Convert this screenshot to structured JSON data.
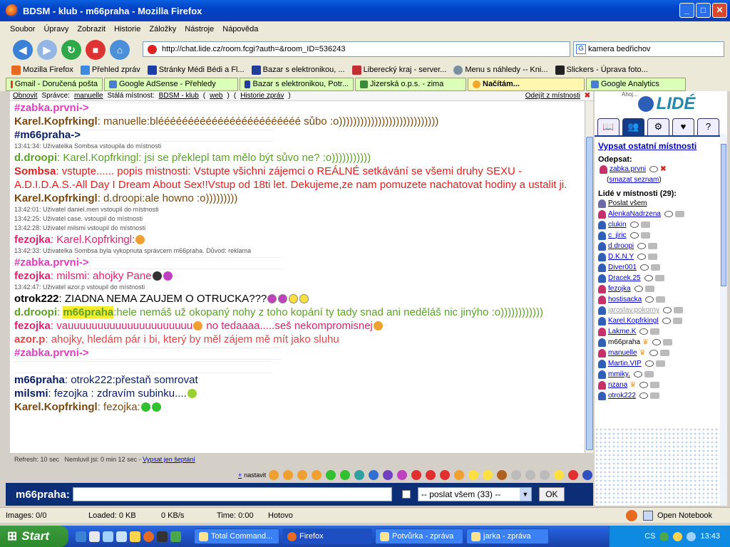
{
  "window": {
    "title": "BDSM - klub - m66praha - Mozilla Firefox"
  },
  "menu": [
    "Soubor",
    "Úpravy",
    "Zobrazit",
    "Historie",
    "Záložky",
    "Nástroje",
    "Nápověda"
  ],
  "address": {
    "url": "http://chat.lide.cz/room.fcgi?auth=&room_ID=536243"
  },
  "search": {
    "value": "kamera bedřichov"
  },
  "bookmarks": [
    {
      "label": "Mozilla Firefox",
      "color": "#e66a1f"
    },
    {
      "label": "Přehled zpráv",
      "color": "#3e8ae0"
    },
    {
      "label": "Stránky Médi Bédi a Fl...",
      "color": "#1b3ea8"
    },
    {
      "label": "Bazar s elektronikou, ...",
      "color": "#223d9a"
    },
    {
      "label": "Liberecký kraj - server...",
      "color": "#c03030"
    },
    {
      "label": "Menu s náhledy -- Kni...",
      "color": "#7a8fa0"
    },
    {
      "label": "Slickers - Úprava foto...",
      "color": "#222222"
    }
  ],
  "tabs": [
    {
      "label": "Gmail - Doručená pošta",
      "active": false
    },
    {
      "label": "Google AdSense - Přehledy",
      "active": false
    },
    {
      "label": "Bazar s elektronikou, Potr...",
      "active": false
    },
    {
      "label": "Jizerská o.p.s. - zima",
      "active": false
    },
    {
      "label": "Načítám...",
      "active": true
    },
    {
      "label": "Google Analytics",
      "active": false
    }
  ],
  "chatbar": {
    "refresh": "Obnovit",
    "admin_label": "Správce:",
    "admin": "manuelle",
    "room_label": "Stálá místnost:",
    "room": "BDSM - klub",
    "web": "web",
    "history": "Historie zpráv",
    "leave": "Odejít z místnosti"
  },
  "messages": [
    {
      "type": "whisper",
      "nick": "#zabka.prvni->",
      "text": "",
      "color": "#e040c0"
    },
    {
      "type": "msg",
      "nick": "Karel.Kopfrkingl",
      "text": ": manuelle:bléééééééééééééééééééééééé sůbo :o))))))))))))))))))))))))))))",
      "color": "#7a4a12"
    },
    {
      "type": "whisper",
      "nick": "#m66praha->",
      "text": "",
      "color": "#0b1f66"
    },
    {
      "type": "sys",
      "text": "13:41:34: Uživatelka Sombsa vstoupila do místnosti"
    },
    {
      "type": "msg",
      "nick": "d.droopi",
      "text": ": Karel.Kopfrkingl: jsi se překlepl tam mělo být sůvo ne? :o)))))))))))",
      "color": "#5ea02c"
    },
    {
      "type": "msg",
      "nick": "Sombsa",
      "text": ": vstupte...... popis mistnosti: Vstupte všichni zájemci o REÁLNÉ setkávání se všemi druhy SEXU - A.D.I.D.A.S.-All Day I Dream About Sex!!Vstup od 18ti let. Dekujeme,ze nam pomuzete nachatovat hodiny a ustalit ji.",
      "color": "#e02020",
      "wrap": true
    },
    {
      "type": "msg",
      "nick": "Karel.Kopfrkingl",
      "text": ": d.droopi:ale howno :o)))))))))",
      "color": "#7a4a12"
    },
    {
      "type": "sys",
      "text": "13:42:01: Uživatel daniel.men vstoupil do místnosti"
    },
    {
      "type": "sys",
      "text": "13:42:25: Uživatel case. vstoupil do místnosti"
    },
    {
      "type": "sys",
      "text": "13:42:28: Uživatel milsmi vstoupil do místnosti"
    },
    {
      "type": "msg",
      "nick": "fezojka",
      "text": ": Karel.Kopfrkingl:",
      "color": "#e0226e"
    },
    {
      "type": "sys",
      "text": "13:42:33: Uživatelka Sombsa byla vykopnuta správcem m66praha. Důvod: reklama"
    },
    {
      "type": "whisper",
      "nick": "#zabka.prvni->",
      "text": "",
      "color": "#e040c0"
    },
    {
      "type": "msg",
      "nick": "fezojka",
      "text": ": milsmi: ahojky Pane",
      "color": "#e0226e"
    },
    {
      "type": "sys",
      "text": "13:42:47: Uživatel azor.p vstoupil do místnosti"
    },
    {
      "type": "msg",
      "nick": "otrok222",
      "text": ": ZIADNA NEMA ZAUJEM O OTRUCKA???",
      "color": "#000000"
    },
    {
      "type": "msg",
      "nick": "d.droopi",
      "text": ": ",
      "highlight": "m66praha",
      "rest": ":hele nemáš už okopaný nohy z toho kopání ty tady snad ani neděláš nic jinýho :o))))))))))))",
      "color": "#5ea02c"
    },
    {
      "type": "msg",
      "nick": "fezojka",
      "text": ": vauuuuuuuuuuuuuuuuuuuuu",
      "rest2": " no tedaaaa.....seš nekompromisnej",
      "color": "#e0226e"
    },
    {
      "type": "msg",
      "nick": "azor.p",
      "text": ": ahojky, hledám pár i bi, který by měl zájem mě mít jako sluhu",
      "color": "#e04848"
    },
    {
      "type": "whisper2",
      "nick": "#zabka.prvni->",
      "text": "",
      "color": "#e040c0"
    },
    {
      "type": "msg",
      "nick": "m66praha",
      "text": ": otrok222:přestaň somrovat",
      "color": "#0b1f66"
    },
    {
      "type": "msg",
      "nick": "milsmi",
      "text": ": fezojka : zdravím subinku....",
      "color": "#0b1f66"
    },
    {
      "type": "msg",
      "nick": "Karel.Kopfrkingl",
      "text": ": fezojka:",
      "color": "#7a4a12"
    }
  ],
  "footer": {
    "refresh": "Refresh: 10 sec",
    "idle": "Nemluvil jsi: 0 min 12 sec",
    "whisper_link": "Vypsat jen šeptání",
    "settings": "nastavit"
  },
  "input": {
    "nick": "m66praha:",
    "recipient": "-- poslat všem (33) --",
    "ok": "OK"
  },
  "sidebar": {
    "logo": "LIDÉ",
    "logo_small": "Ahoj...",
    "list_rooms": "Vypsat ostatní místnosti",
    "unsubscribe": "Odepsat:",
    "sub_user": "zabka.prvni",
    "clear": "smazat seznam",
    "people": "Lidé v místnosti (29):",
    "send_all": "Poslat všem",
    "users": [
      {
        "name": "AlenkaNadrzena",
        "color": "#c8306a"
      },
      {
        "name": "clukin",
        "color": "#2f5fb8"
      },
      {
        "name": "c_jiric",
        "color": "#2f5fb8"
      },
      {
        "name": "d.droopi",
        "color": "#2f5fb8"
      },
      {
        "name": "D.K.N.Y",
        "color": "#2f5fb8"
      },
      {
        "name": "Diver001",
        "color": "#2f5fb8"
      },
      {
        "name": "Dracek.25",
        "color": "#2f5fb8"
      },
      {
        "name": "fezojka",
        "color": "#c8306a"
      },
      {
        "name": "hostisacka",
        "color": "#c8306a"
      },
      {
        "name": "jaroslav.pokorny",
        "color": "#2f5fb8"
      },
      {
        "name": "Karel.Kopfrkingl",
        "color": "#2f5fb8"
      },
      {
        "name": "Lakme.K",
        "color": "#c8306a"
      },
      {
        "name": "m66praha",
        "color": "#2f5fb8"
      },
      {
        "name": "manuelle",
        "color": "#c8306a"
      },
      {
        "name": "Martin.VIP",
        "color": "#2f5fb8"
      },
      {
        "name": "mmiky.",
        "color": "#2f5fb8"
      },
      {
        "name": "nzana",
        "color": "#c8306a"
      },
      {
        "name": "otrok222",
        "color": "#2f5fb8"
      }
    ]
  },
  "status": {
    "images": "Images: 0/0",
    "loaded": "Loaded: 0 KB",
    "speed": "0 KB/s",
    "time": "Time: 0:00",
    "state": "Hotovo",
    "notebook": "Open Notebook"
  },
  "taskbar": {
    "start": "Start",
    "tasks": [
      {
        "label": "Total Command...",
        "active": false
      },
      {
        "label": "Firefox",
        "active": true
      },
      {
        "label": "Potvůrka - zpráva",
        "active": false
      },
      {
        "label": "jarka - zpráva",
        "active": false
      }
    ],
    "lang": "CS",
    "clock": "13:43"
  }
}
